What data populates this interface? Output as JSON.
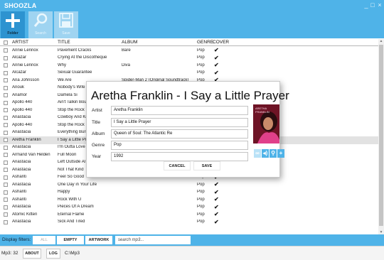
{
  "window": {
    "title": "SHOOZLA",
    "controls": {
      "minimize": "_",
      "maximize": "□",
      "close": "×"
    }
  },
  "toolbar": {
    "folder": {
      "label": "Folder",
      "icon": "plus-icon"
    },
    "search": {
      "label": "Search",
      "icon": "search-icon"
    },
    "save": {
      "label": "Save",
      "icon": "save-icon"
    }
  },
  "grid": {
    "columns": [
      "ARTIST",
      "TITLE",
      "ALBUM",
      "GENRE",
      "COVER"
    ],
    "rows": [
      {
        "artist": "Annie Lennox",
        "title": "Pavement Cracks",
        "album": "Bare",
        "genre": "Pop",
        "cover": "✔"
      },
      {
        "artist": "Alcazar",
        "title": "Crying At the Discotheque",
        "album": "",
        "genre": "Pop",
        "cover": "✔"
      },
      {
        "artist": "Annie Lennox",
        "title": "Why",
        "album": "Diva",
        "genre": "Pop",
        "cover": "✔"
      },
      {
        "artist": "Alcazar",
        "title": "Sexual Guarantee",
        "album": "",
        "genre": "Pop",
        "cover": "✔"
      },
      {
        "artist": "Ana Johnsson",
        "title": "We Are",
        "album": "Spider-Man 2 (Original Soundtrack)",
        "genre": "Pop",
        "cover": "✔"
      },
      {
        "artist": "Anouk",
        "title": "Nobody's Wife",
        "album": "",
        "genre": "",
        "cover": ""
      },
      {
        "artist": "Anamor",
        "title": "Damela Si",
        "album": "",
        "genre": "",
        "cover": ""
      },
      {
        "artist": "Apollo 440",
        "title": "Ain't Talkin Bou",
        "album": "",
        "genre": "",
        "cover": ""
      },
      {
        "artist": "Apollo 440",
        "title": "Stop the Rock",
        "album": "",
        "genre": "",
        "cover": ""
      },
      {
        "artist": "Anastacia",
        "title": "Cowboy And Ki",
        "album": "",
        "genre": "",
        "cover": ""
      },
      {
        "artist": "Apollo 440",
        "title": "Stop the Rock",
        "album": "",
        "genre": "",
        "cover": ""
      },
      {
        "artist": "Anastacia",
        "title": "Everything Burn",
        "album": "",
        "genre": "",
        "cover": ""
      },
      {
        "artist": "Aretha Franklin",
        "title": "I Say a Little Pr",
        "album": "",
        "genre": "",
        "cover": "",
        "selected": true
      },
      {
        "artist": "Anastacia",
        "title": "I'm Outta Love",
        "album": "",
        "genre": "",
        "cover": ""
      },
      {
        "artist": "Armand Van Helden",
        "title": "Full Moon",
        "album": "",
        "genre": "",
        "cover": ""
      },
      {
        "artist": "Anastacia",
        "title": "Left Outside Al",
        "album": "",
        "genre": "",
        "cover": ""
      },
      {
        "artist": "Anastacia",
        "title": "Not That Kind",
        "album": "",
        "genre": "",
        "cover": ""
      },
      {
        "artist": "Ashanti",
        "title": "Feel So Good",
        "album": "",
        "genre": "Pop",
        "cover": "✔"
      },
      {
        "artist": "Anastacia",
        "title": "One Day in Your Life",
        "album": "",
        "genre": "Pop",
        "cover": "✔"
      },
      {
        "artist": "Ashanti",
        "title": "Happy",
        "album": "",
        "genre": "Pop",
        "cover": "✔"
      },
      {
        "artist": "Ashanti",
        "title": "Rock With U",
        "album": "",
        "genre": "Pop",
        "cover": "✔"
      },
      {
        "artist": "Anastacia",
        "title": "Pieces Of A Dream",
        "album": "",
        "genre": "Pop",
        "cover": "✔"
      },
      {
        "artist": "Atomic Kitten",
        "title": "Eternal Flame",
        "album": "",
        "genre": "Pop",
        "cover": "✔"
      },
      {
        "artist": "Anastacia",
        "title": "Sick And Tired",
        "album": "",
        "genre": "Pop",
        "cover": "✔"
      }
    ]
  },
  "filters": {
    "label": "Display filters:",
    "all": "ALL",
    "empty": "EMPTY",
    "artwork": "ARTWORK",
    "search_placeholder": "search mp3..."
  },
  "status": {
    "count": "Mp3: 32",
    "about": "ABOUT",
    "log": "LOG",
    "path": "C:\\Mp3"
  },
  "dialog": {
    "title": "Aretha Franklin - I Say a Little Prayer",
    "fields": {
      "artist_label": "Artist",
      "artist": "Aretha Franklin",
      "title_label": "Title",
      "title": "I Say a Little Prayer",
      "album_label": "Album",
      "album": "Queen of Soul: The Atlantic Re",
      "genre_label": "Genre",
      "genre": "Pop",
      "year_label": "Year",
      "year": "1992"
    },
    "cover_text": {
      "artist": "ARETHA",
      "name": "FRANKLIN"
    },
    "cancel": "CANCEL",
    "save": "SAVE",
    "art_tools": [
      "link-icon",
      "speaker-icon",
      "search-icon",
      "plus-icon"
    ]
  }
}
